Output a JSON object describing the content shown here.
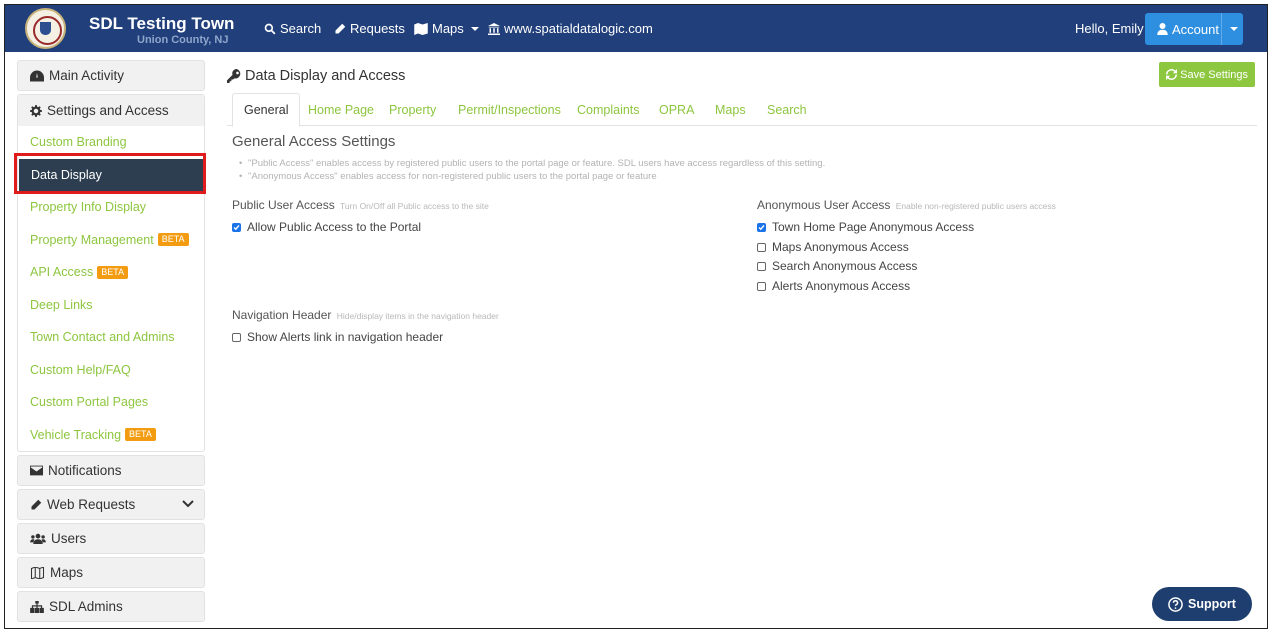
{
  "navbar": {
    "town_name": "SDL Testing Town",
    "county": "Union County, NJ",
    "links": {
      "search": "Search",
      "requests": "Requests",
      "maps": "Maps",
      "website": "www.spatialdatalogic.com"
    },
    "greeting": "Hello, Emily",
    "account_label": "Account"
  },
  "sidebar": {
    "main_activity": "Main Activity",
    "settings_access": "Settings and Access",
    "sub_items": {
      "custom_branding": "Custom Branding",
      "data_display": "Data Display",
      "property_info_display": "Property Info Display",
      "property_management": "Property Management",
      "api_access": "API Access",
      "deep_links": "Deep Links",
      "town_contact": "Town Contact and Admins",
      "custom_help": "Custom Help/FAQ",
      "custom_portal_pages": "Custom Portal Pages",
      "vehicle_tracking": "Vehicle Tracking"
    },
    "beta_label": "BETA",
    "notifications": "Notifications",
    "web_requests": "Web Requests",
    "users": "Users",
    "maps": "Maps",
    "sdl_admins": "SDL Admins"
  },
  "main": {
    "page_title": "Data Display and Access",
    "save_label": "Save Settings",
    "tabs": {
      "general": "General",
      "home_page": "Home Page",
      "property": "Property",
      "permit": "Permit/Inspections",
      "complaints": "Complaints",
      "opra": "OPRA",
      "maps": "Maps",
      "search": "Search"
    },
    "section_title": "General Access Settings",
    "notes": [
      "\"Public Access\" enables access by registered public users to the portal page or feature. SDL users have access regardless of this setting.",
      "\"Anonymous Access\" enables access for non-registered public users to the portal page or feature"
    ],
    "public_access": {
      "label": "Public User Access",
      "hint": "Turn On/Off all Public access to the site",
      "allow_label": "Allow Public Access to the Portal",
      "allow_checked": true
    },
    "anonymous_access": {
      "label": "Anonymous User Access",
      "hint": "Enable non-registered public users access",
      "items": [
        {
          "label": "Town Home Page Anonymous Access",
          "checked": true
        },
        {
          "label": "Maps Anonymous Access",
          "checked": false
        },
        {
          "label": "Search Anonymous Access",
          "checked": false
        },
        {
          "label": "Alerts Anonymous Access",
          "checked": false
        }
      ]
    },
    "navigation_header": {
      "label": "Navigation Header",
      "hint": "Hide/display items in the navigation header",
      "show_alerts_label": "Show Alerts link in navigation header",
      "show_alerts_checked": false
    }
  },
  "support_label": "Support",
  "colors": {
    "navbar_bg": "#213f7a",
    "accent_green": "#8dc63f",
    "active_dark": "#2c3e50",
    "account_blue": "#2e8fe0",
    "beta_orange": "#f39c12",
    "highlight_red": "#e01b1b",
    "support_navy": "#1d3e6e"
  }
}
